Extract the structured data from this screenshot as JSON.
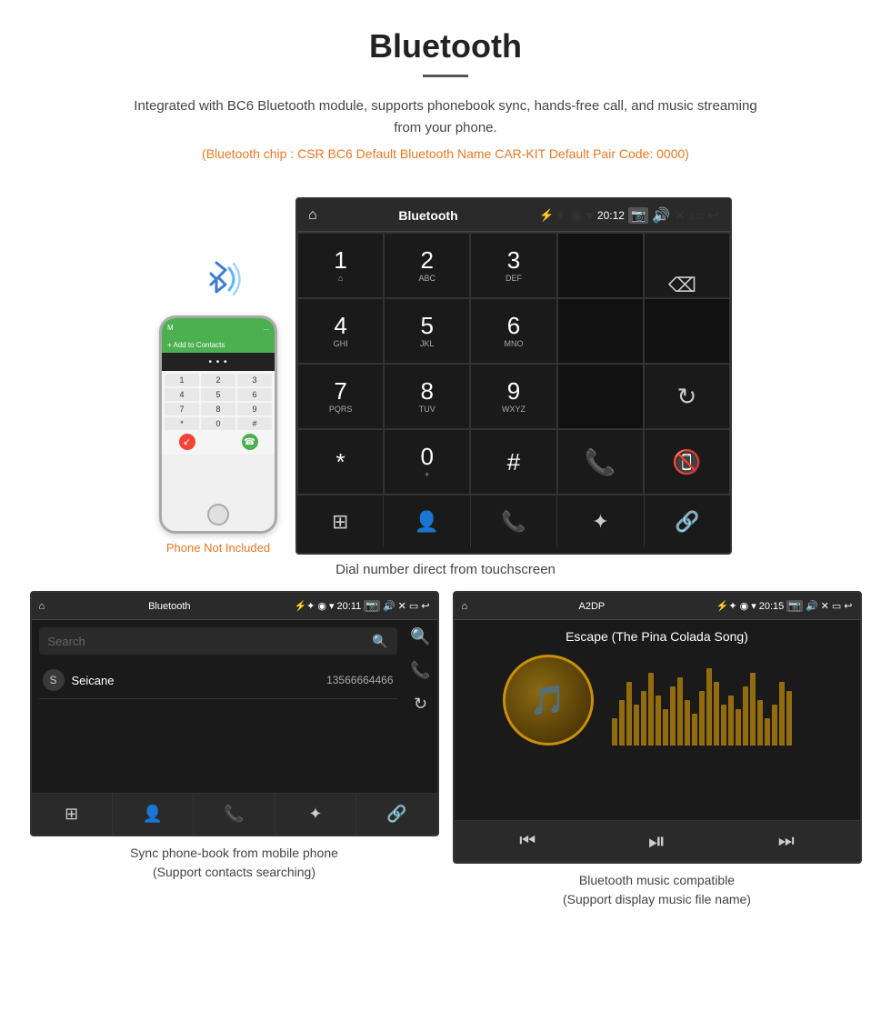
{
  "header": {
    "title": "Bluetooth",
    "description": "Integrated with BC6 Bluetooth module, supports phonebook sync, hands-free call, and music streaming from your phone.",
    "specs": "(Bluetooth chip : CSR BC6    Default Bluetooth Name CAR-KIT    Default Pair Code: 0000)"
  },
  "dialpad_screen": {
    "title": "Bluetooth",
    "time": "20:12",
    "keys": [
      {
        "number": "1",
        "letters": "⌂"
      },
      {
        "number": "2",
        "letters": "ABC"
      },
      {
        "number": "3",
        "letters": "DEF"
      },
      {
        "number": "",
        "letters": ""
      },
      {
        "number": "⌫",
        "letters": ""
      },
      {
        "number": "4",
        "letters": "GHI"
      },
      {
        "number": "5",
        "letters": "JKL"
      },
      {
        "number": "6",
        "letters": "MNO"
      },
      {
        "number": "",
        "letters": ""
      },
      {
        "number": "",
        "letters": ""
      },
      {
        "number": "7",
        "letters": "PQRS"
      },
      {
        "number": "8",
        "letters": "TUV"
      },
      {
        "number": "9",
        "letters": "WXYZ"
      },
      {
        "number": "",
        "letters": ""
      },
      {
        "number": "↻",
        "letters": ""
      },
      {
        "number": "*",
        "letters": ""
      },
      {
        "number": "0",
        "letters": "+"
      },
      {
        "number": "#",
        "letters": ""
      },
      {
        "number": "📞",
        "letters": ""
      },
      {
        "number": "📵",
        "letters": ""
      }
    ],
    "bottom_tabs": [
      "⊞",
      "👤",
      "📞",
      "🔵",
      "🔗"
    ]
  },
  "dial_caption": "Dial number direct from touchscreen",
  "phonebook_screen": {
    "header_title": "Bluetooth",
    "time": "20:11",
    "search_placeholder": "Search",
    "contacts": [
      {
        "letter": "S",
        "name": "Seicane",
        "number": "13566664466"
      }
    ],
    "bottom_tabs": [
      "⊞",
      "👤",
      "📞",
      "🔵",
      "🔗"
    ]
  },
  "phonebook_caption_line1": "Sync phone-book from mobile phone",
  "phonebook_caption_line2": "(Support contacts searching)",
  "music_screen": {
    "header_title": "A2DP",
    "time": "20:15",
    "song_title": "Escape (The Pina Colada Song)",
    "eq_bars": [
      30,
      50,
      70,
      45,
      60,
      80,
      55,
      40,
      65,
      75,
      50,
      35,
      60,
      85,
      70,
      45,
      55,
      40,
      65,
      80,
      50,
      30,
      45,
      70,
      60
    ]
  },
  "music_caption_line1": "Bluetooth music compatible",
  "music_caption_line2": "(Support display music file name)",
  "phone_not_included": "Phone Not Included"
}
